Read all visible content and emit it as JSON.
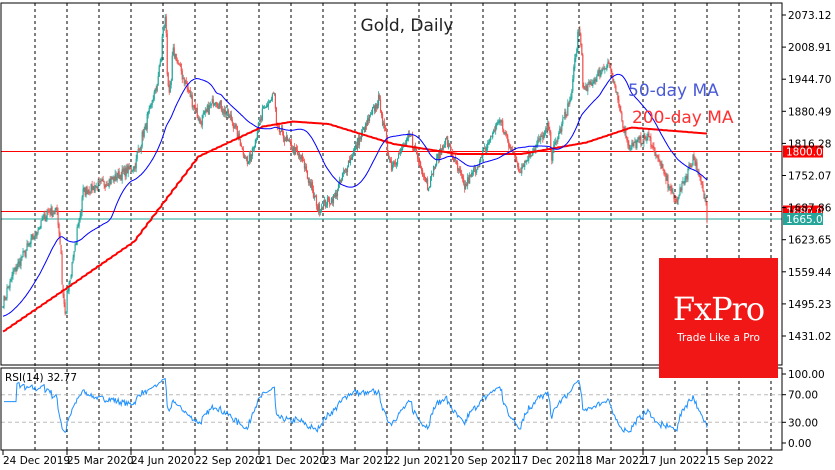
{
  "chart_data": {
    "type": "candlestick",
    "title": "Gold, Daily",
    "price_ticks": [
      2073.12,
      2008.91,
      1944.7,
      1880.49,
      1816.28,
      1752.07,
      1687.86,
      1623.65,
      1559.44,
      1495.23,
      1431.02
    ],
    "price_tick_labels": [
      "2073.12",
      "2008.91",
      "1944.70",
      "1880.49",
      "1816.28",
      "1752.07",
      "1687.86",
      "1623.65",
      "1559.44",
      "1495.23",
      "1431.02"
    ],
    "date_labels": [
      "24 Dec 2019",
      "25 Mar 2020",
      "24 Jun 2020",
      "22 Sep 2020",
      "21 Dec 2020",
      "23 Mar 2021",
      "22 Jun 2021",
      "20 Sep 2021",
      "17 Dec 2021",
      "18 Mar 2022",
      "17 Jun 2022",
      "15 Sep 2022"
    ],
    "close_keypoints": [
      [
        "2019-12-24",
        1500
      ],
      [
        "2020-01-08",
        1560
      ],
      [
        "2020-02-24",
        1680
      ],
      [
        "2020-03-09",
        1680
      ],
      [
        "2020-03-19",
        1475
      ],
      [
        "2020-04-14",
        1720
      ],
      [
        "2020-05-18",
        1740
      ],
      [
        "2020-06-24",
        1770
      ],
      [
        "2020-07-27",
        1940
      ],
      [
        "2020-08-06",
        2065
      ],
      [
        "2020-08-12",
        1910
      ],
      [
        "2020-08-18",
        2000
      ],
      [
        "2020-09-24",
        1860
      ],
      [
        "2020-10-15",
        1905
      ],
      [
        "2020-11-09",
        1860
      ],
      [
        "2020-11-30",
        1775
      ],
      [
        "2020-12-21",
        1880
      ],
      [
        "2021-01-06",
        1915
      ],
      [
        "2021-01-08",
        1850
      ],
      [
        "2021-02-15",
        1780
      ],
      [
        "2021-03-08",
        1685
      ],
      [
        "2021-03-31",
        1710
      ],
      [
        "2021-04-20",
        1780
      ],
      [
        "2021-05-10",
        1840
      ],
      [
        "2021-06-01",
        1905
      ],
      [
        "2021-06-18",
        1770
      ],
      [
        "2021-07-15",
        1830
      ],
      [
        "2021-08-09",
        1730
      ],
      [
        "2021-08-20",
        1780
      ],
      [
        "2021-09-03",
        1825
      ],
      [
        "2021-09-29",
        1730
      ],
      [
        "2021-10-20",
        1780
      ],
      [
        "2021-11-16",
        1865
      ],
      [
        "2021-12-15",
        1765
      ],
      [
        "2022-01-25",
        1850
      ],
      [
        "2022-01-28",
        1790
      ],
      [
        "2022-02-24",
        1905
      ],
      [
        "2022-03-08",
        2050
      ],
      [
        "2022-03-15",
        1920
      ],
      [
        "2022-04-18",
        1980
      ],
      [
        "2022-05-16",
        1810
      ],
      [
        "2022-06-13",
        1830
      ],
      [
        "2022-07-21",
        1700
      ],
      [
        "2022-08-15",
        1790
      ],
      [
        "2022-09-01",
        1700
      ],
      [
        "2022-09-02",
        1665
      ]
    ],
    "ma200_keypoints": [
      [
        "2019-12-24",
        1440
      ],
      [
        "2020-03-25",
        1530
      ],
      [
        "2020-06-24",
        1620
      ],
      [
        "2020-09-22",
        1790
      ],
      [
        "2020-12-21",
        1850
      ],
      [
        "2021-02-01",
        1860
      ],
      [
        "2021-03-23",
        1855
      ],
      [
        "2021-06-22",
        1815
      ],
      [
        "2021-09-20",
        1795
      ],
      [
        "2021-12-17",
        1795
      ],
      [
        "2022-03-18",
        1818
      ],
      [
        "2022-05-20",
        1848
      ],
      [
        "2022-09-02",
        1836
      ]
    ],
    "ma50_label": "50-day MA",
    "ma200_label": "200-day MA",
    "horizontal_levels": [
      {
        "value": 1800.0,
        "label": "1800.00",
        "color": "#ff0000"
      },
      {
        "value": 1680.0,
        "label": "1680.00",
        "color": "#ff0000"
      },
      {
        "value": 1665.06,
        "label": "1665.06",
        "color": "#26a69a"
      }
    ],
    "rsi": {
      "label": "RSI(14) 32.77",
      "ticks": [
        "100.00",
        "70.00",
        "30.00",
        "0.00"
      ],
      "levels": [
        70,
        30
      ],
      "range": [
        0,
        100
      ]
    },
    "colors": {
      "up": "#26a69a",
      "down": "#ef5350",
      "ma50": "#0000ff",
      "ma200": "#ff0000",
      "rsi": "#1e90ff"
    }
  },
  "logo": {
    "name": "FxPro",
    "tagline": "Trade Like a Pro",
    "color": "#f21717"
  }
}
